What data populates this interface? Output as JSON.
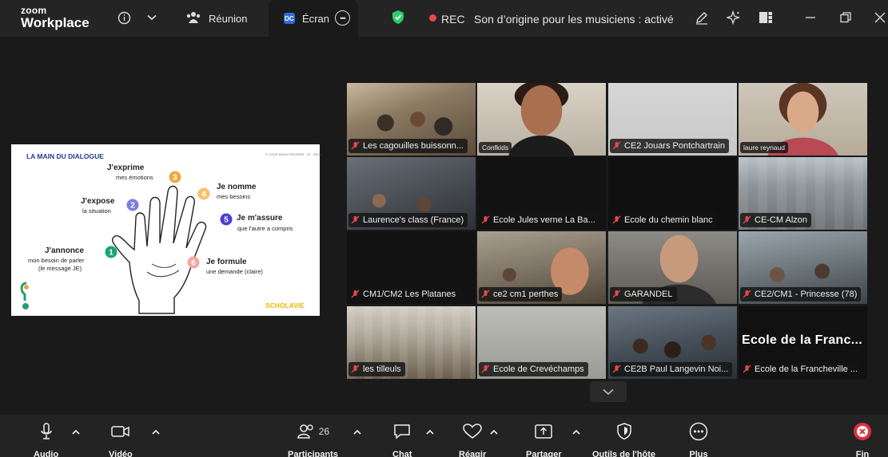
{
  "app": {
    "brand_top": "zoom",
    "brand_bottom": "Workplace"
  },
  "topbar": {
    "meeting_tab": "Réunion",
    "screen_badge": "DC",
    "screen_tab": "Écran",
    "rec_label": "REC",
    "audio_status": "Son d’origine pour les musiciens : activé"
  },
  "slide": {
    "title": "LA MAIN DU DIALOGUE",
    "corner": "© VOUS SAVEZ RÉUSSIR · 10 · 2023",
    "steps": [
      {
        "num": "1",
        "head": "J'annonce",
        "sub1": "mon besoin de parler",
        "sub2": "(le message JE)"
      },
      {
        "num": "2",
        "head": "J'expose",
        "sub1": "la situation"
      },
      {
        "num": "3",
        "head": "J'exprime",
        "sub1": "mes émotions"
      },
      {
        "num": "4",
        "head": "Je nomme",
        "sub1": "mes besoins"
      },
      {
        "num": "5",
        "head": "Je m'assure",
        "sub1": "que l'autre a compris"
      },
      {
        "num": "6",
        "head": "Je formule",
        "sub1": "une demande (claire)"
      }
    ],
    "logo": "SCHOLAVIE",
    "colors": {
      "s1": "#1aa37a",
      "s2": "#7b7fe0",
      "s3": "#f0a840",
      "s4": "#f5c36b",
      "s5": "#4b3fd6",
      "s6": "#f4a6a0",
      "title": "#1f3a93",
      "logo": "#f0b400"
    }
  },
  "participants": [
    {
      "name": "Les cagouilles buissonn...",
      "muted": true
    },
    {
      "name": "Confkids",
      "muted": false,
      "small": true
    },
    {
      "name": "CE2 Jouars Pontchartrain",
      "muted": true
    },
    {
      "name": "laure reynaud",
      "muted": false,
      "small": true,
      "active_speaker": true
    },
    {
      "name": "Laurence's class (France)",
      "muted": true
    },
    {
      "name": "Ecole Jules verne La Ba...",
      "muted": true
    },
    {
      "name": "Ecole du chemin blanc",
      "muted": true
    },
    {
      "name": "CE-CM Alzon",
      "muted": true
    },
    {
      "name": "CM1/CM2 Les Platanes",
      "muted": true
    },
    {
      "name": "ce2 cm1 perthes",
      "muted": true
    },
    {
      "name": "GARANDEL",
      "muted": true
    },
    {
      "name": "CE2/CM1 - Princesse (78)",
      "muted": true
    },
    {
      "name": "les tilleuls",
      "muted": true
    },
    {
      "name": "Ecole de Crevéchamps",
      "muted": true
    },
    {
      "name": "CE2B Paul Langevin Noi...",
      "muted": true
    },
    {
      "name": "Ecole de la Francheville ...",
      "muted": true,
      "big_name": "Ecole de la Franc..."
    }
  ],
  "toolbar": {
    "audio": "Audio",
    "video": "Vidéo",
    "participants": "Participants",
    "participants_count": "26",
    "chat": "Chat",
    "react": "Réagir",
    "share": "Partager",
    "host_tools": "Outils de l'hôte",
    "more": "Plus",
    "end": "Fin"
  },
  "theme": {
    "accent_green": "#2ecc71",
    "rec_red": "#e5484d",
    "end_red": "#e0303a",
    "bar": "#242424"
  }
}
